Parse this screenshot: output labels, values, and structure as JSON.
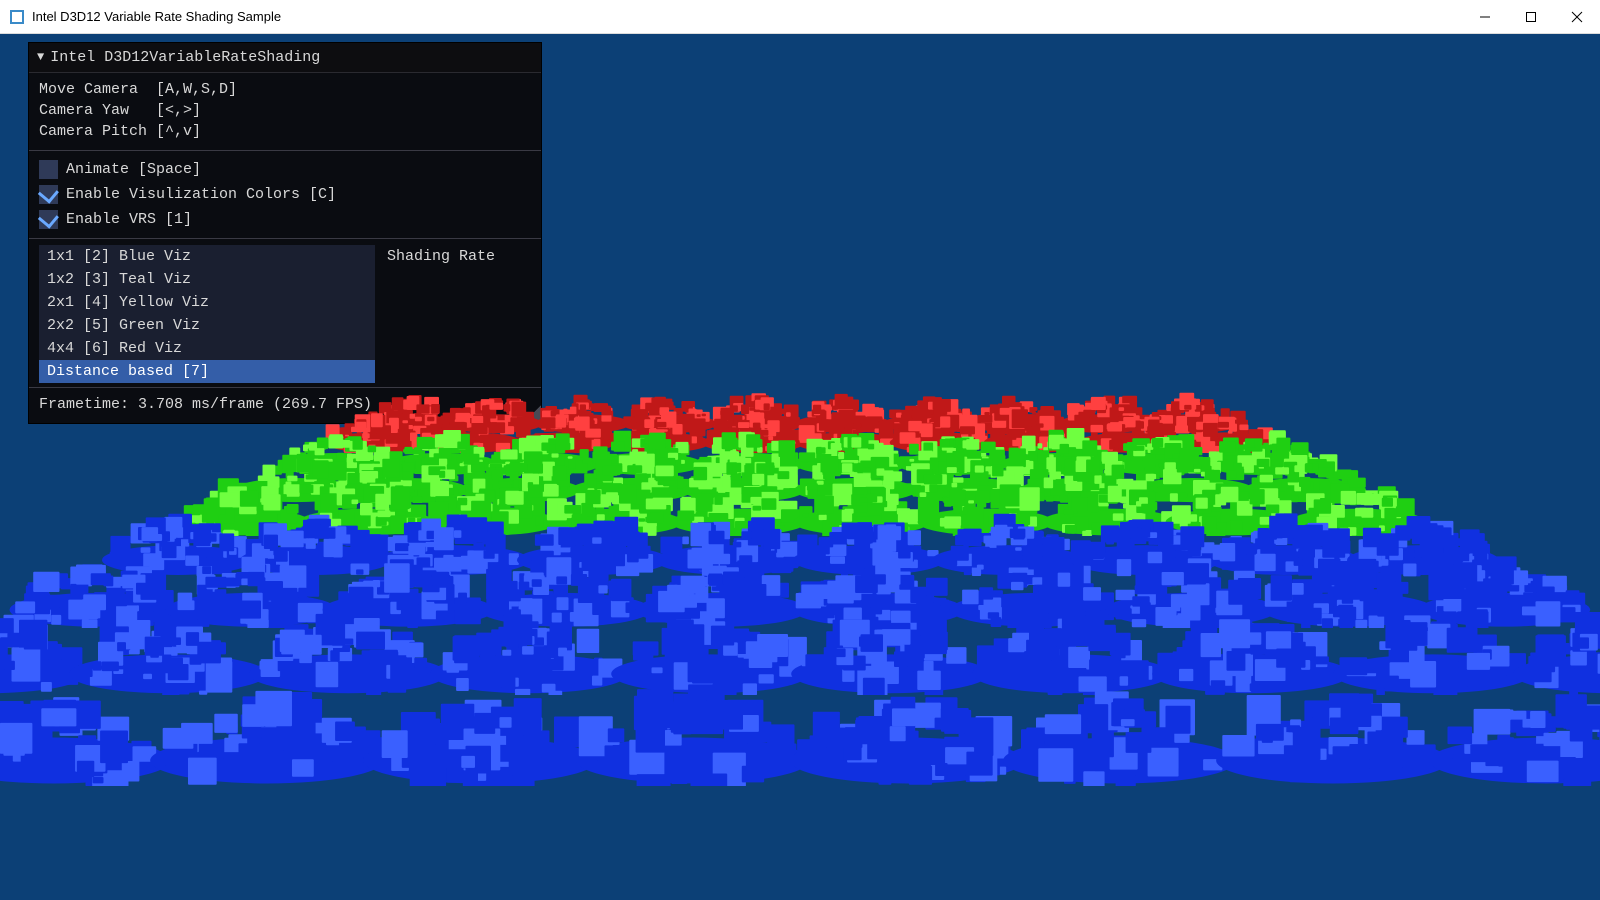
{
  "window": {
    "title": "Intel D3D12 Variable Rate Shading Sample"
  },
  "panel": {
    "title": "Intel D3D12VariableRateShading",
    "help": {
      "move": "Move Camera  [A,W,S,D]",
      "yaw": "Camera Yaw   [<,>]",
      "pitch": "Camera Pitch [^,v]"
    },
    "animate": {
      "label": "Animate [Space]",
      "checked": false
    },
    "viscolors": {
      "label": "Enable Visulization Colors [C]",
      "checked": true
    },
    "enablevrs": {
      "label": "Enable VRS [1]",
      "checked": true
    },
    "shading_rate_label": "Shading Rate",
    "shading_rate_items": [
      "1x1 [2] Blue Viz",
      "1x2 [3] Teal Viz",
      "2x1 [4] Yellow Viz",
      "2x2 [5] Green Viz",
      "4x4 [6] Red Viz",
      "Distance based [7]"
    ],
    "shading_rate_selected": 5,
    "frametime": "Frametime: 3.708 ms/frame (269.7 FPS)"
  },
  "colors": {
    "background": "#0c4076",
    "island_blue": "#1030e0",
    "island_blue_hi": "#3a60ff",
    "island_green": "#1fcf12",
    "island_green_hi": "#6fff40",
    "island_red": "#c01818",
    "island_red_hi": "#ff4040"
  }
}
